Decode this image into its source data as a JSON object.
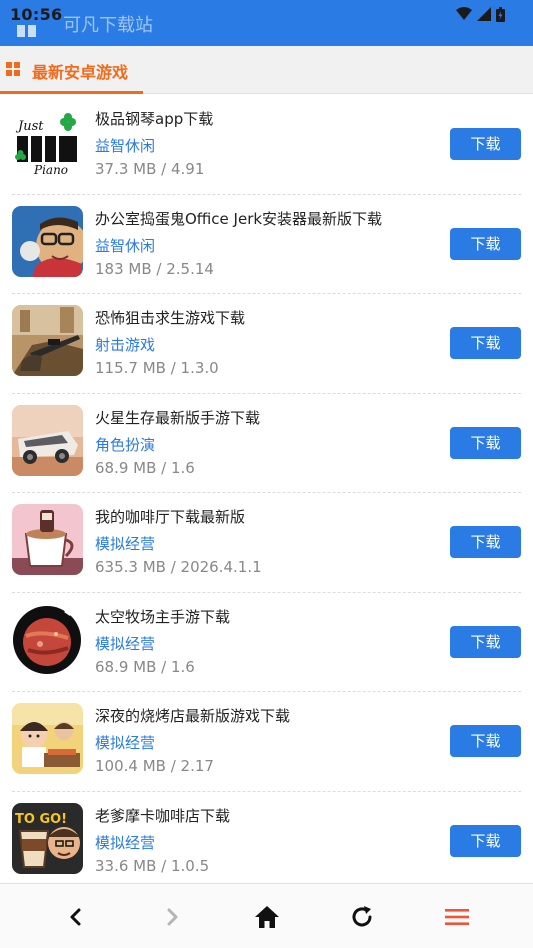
{
  "status_bar": {
    "time": "10:56"
  },
  "header": {
    "title": "可凡下载站"
  },
  "section": {
    "title": "最新安卓游戏"
  },
  "items": [
    {
      "title": "极品钢琴app下载",
      "category": "益智休闲",
      "meta": "37.3 MB / 4.91",
      "button": "下载",
      "icon": "piano-app-icon",
      "icon_text_1": "Just",
      "icon_text_2": "Piano"
    },
    {
      "title": "办公室捣蛋鬼Office Jerk安装器最新版下载",
      "category": "益智休闲",
      "meta": "183 MB / 2.5.14",
      "button": "下载",
      "icon": "office-jerk-app-icon"
    },
    {
      "title": "恐怖狙击求生游戏下载",
      "category": "射击游戏",
      "meta": "115.7 MB / 1.3.0",
      "button": "下载",
      "icon": "sniper-app-icon"
    },
    {
      "title": "火星生存最新版手游下载",
      "category": "角色扮演",
      "meta": "68.9 MB / 1.6",
      "button": "下载",
      "icon": "mars-rover-app-icon"
    },
    {
      "title": "我的咖啡厅下载最新版",
      "category": "模拟经营",
      "meta": "635.3 MB / 2026.4.1.1",
      "button": "下载",
      "icon": "coffee-cup-app-icon"
    },
    {
      "title": "太空牧场主手游下载",
      "category": "模拟经营",
      "meta": "68.9 MB / 1.6",
      "button": "下载",
      "icon": "planet-app-icon"
    },
    {
      "title": "深夜的烧烤店最新版游戏下载",
      "category": "模拟经营",
      "meta": "100.4 MB / 2.17",
      "button": "下载",
      "icon": "bbq-shop-app-icon"
    },
    {
      "title": "老爹摩卡咖啡店下载",
      "category": "模拟经营",
      "meta": "33.6 MB / 1.0.5",
      "button": "下载",
      "icon": "papa-mocha-app-icon",
      "icon_text_1": "TO GO!"
    }
  ],
  "bottom_nav": [
    "back-icon",
    "forward-icon",
    "home-icon",
    "refresh-icon",
    "menu-icon"
  ],
  "colors": {
    "primary": "#2a7be4",
    "accent": "#f26b1d",
    "muted": "#888888"
  }
}
